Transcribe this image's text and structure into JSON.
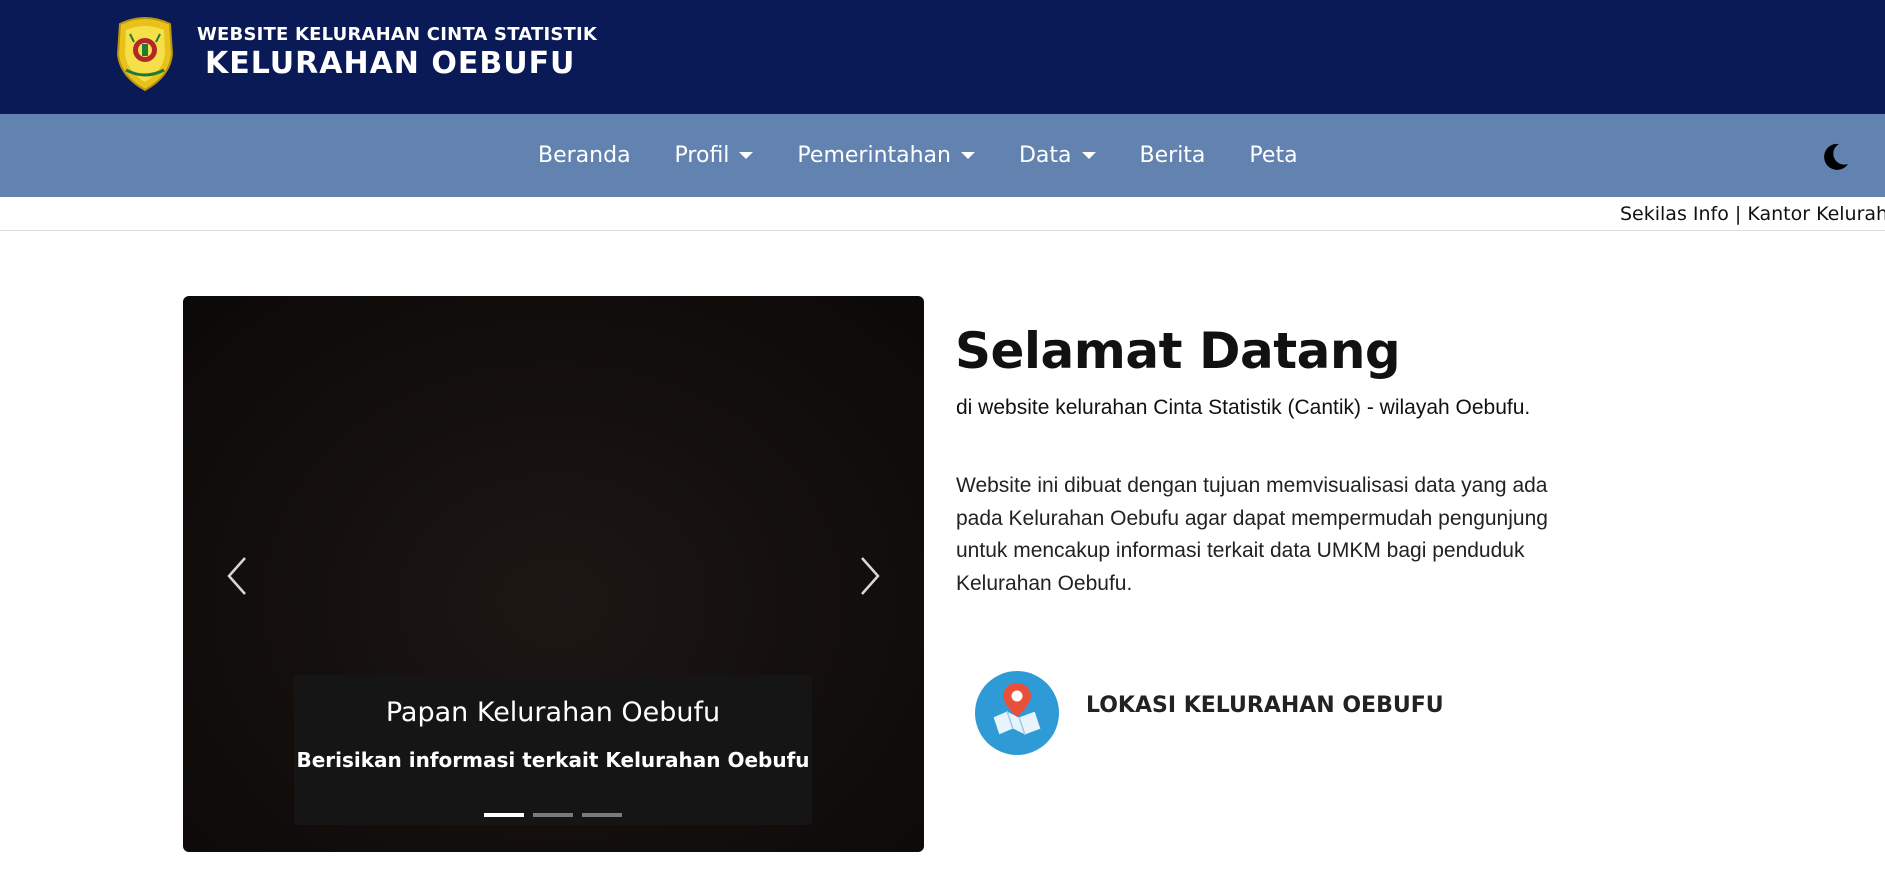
{
  "header": {
    "subtitle": "WEBSITE KELURAHAN CINTA STATISTIK",
    "title": "KELURAHAN OEBUFU",
    "logo_icon": "regional-emblem-icon"
  },
  "nav": {
    "items": [
      {
        "label": "Beranda",
        "dropdown": false
      },
      {
        "label": "Profil",
        "dropdown": true
      },
      {
        "label": "Pemerintahan",
        "dropdown": true
      },
      {
        "label": "Data",
        "dropdown": true
      },
      {
        "label": "Berita",
        "dropdown": false
      },
      {
        "label": "Peta",
        "dropdown": false
      }
    ],
    "theme_toggle_icon": "moon-icon"
  },
  "ticker": {
    "text": "Sekilas Info | Kantor Kelurahan"
  },
  "carousel": {
    "caption_title": "Papan Kelurahan Oebufu",
    "caption_text": "Berisikan informasi terkait Kelurahan Oebufu",
    "slide_count": 3,
    "active_slide": 1
  },
  "welcome": {
    "title": "Selamat Datang",
    "subtitle": "di website kelurahan Cinta Statistik (Cantik) - wilayah Oebufu.",
    "description": "Website ini dibuat dengan tujuan memvisualisasi data yang ada pada Kelurahan Oebufu agar dapat mempermudah pengunjung untuk mencakup informasi terkait data UMKM bagi penduduk Kelurahan Oebufu."
  },
  "location": {
    "label": "LOKASI KELURAHAN OEBUFU",
    "icon": "map-pin-icon"
  },
  "colors": {
    "header_bg": "#0a1a56",
    "nav_bg": "#6282af",
    "map_icon_bg": "#2f9bd6",
    "pin_red": "#e8503a"
  }
}
